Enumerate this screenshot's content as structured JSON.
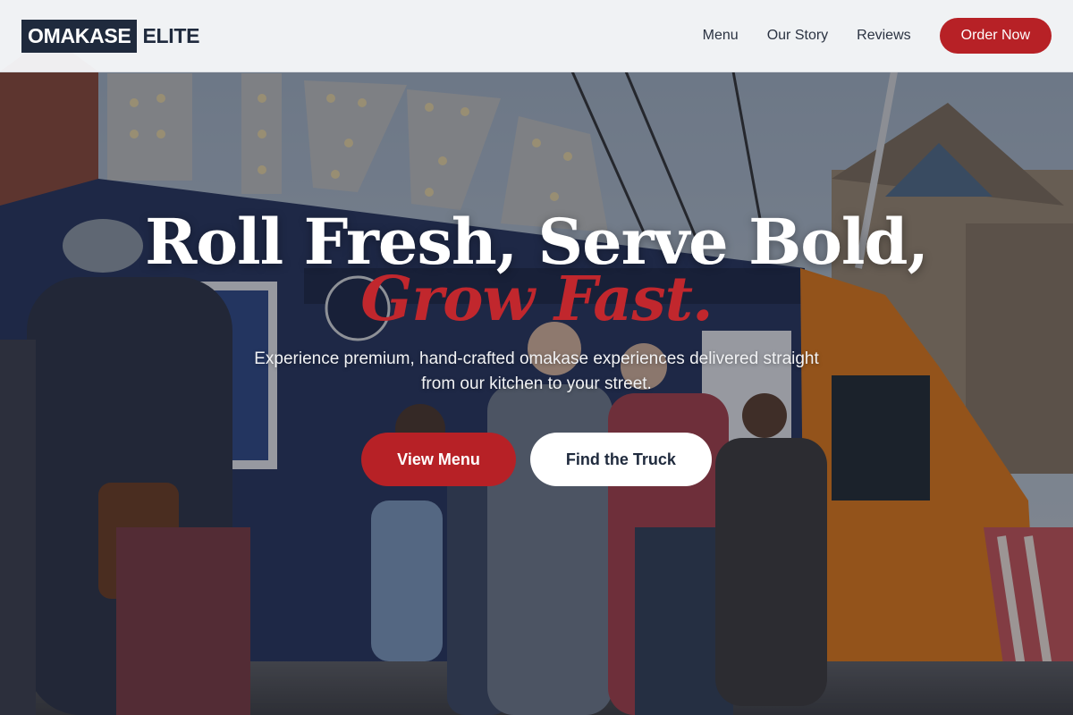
{
  "brand": {
    "name_main": "OMAKASE",
    "name_sub": "ELITE"
  },
  "nav": {
    "links": [
      {
        "label": "Menu"
      },
      {
        "label": "Our Story"
      },
      {
        "label": "Reviews"
      }
    ],
    "order_button": "Order Now"
  },
  "hero": {
    "headline": "Roll Fresh, Serve Bold,",
    "headline_accent": "Grow Fast.",
    "subtext": "Experience premium, hand-crafted omakase experiences delivered straight from our kitchen to your street.",
    "primary_cta": "View Menu",
    "secondary_cta": "Find the Truck"
  },
  "colors": {
    "brand_navy": "#1f2a3d",
    "accent_red": "#b72126",
    "nav_background": "#f6f7f9"
  }
}
